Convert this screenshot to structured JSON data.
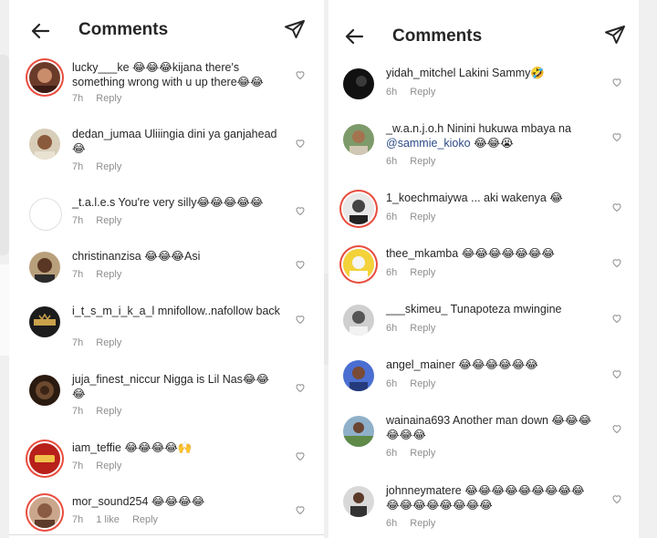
{
  "left": {
    "title": "Comments",
    "comments": [
      {
        "user": "lucky___ke",
        "text": "😂😂😂kijana there's something wrong with u up there😂😂",
        "time": "7h",
        "reply": "Reply",
        "avatar": "photo-woman",
        "ring": true
      },
      {
        "user": "dedan_jumaa",
        "text": "Uliiingia dini ya ganjahead 😂",
        "time": "7h",
        "reply": "Reply",
        "avatar": "photo-man"
      },
      {
        "user": "_t.a.l.e.s",
        "text": "You're very silly😂😂😂😂😂",
        "time": "7h",
        "reply": "Reply",
        "avatar": "blank"
      },
      {
        "user": "christinanzisa",
        "text": "😂😂😂Asi",
        "time": "7h",
        "reply": "Reply",
        "avatar": "photo-woman2"
      },
      {
        "user": "i_t_s_m_i_k_a_l",
        "text": "mnifollow..nafollow back",
        "time": "7h",
        "reply": "Reply",
        "avatar": "logo-mokina"
      },
      {
        "user": "juja_finest_niccur",
        "text": "Nigga is Lil Nas😂😂😂",
        "time": "7h",
        "reply": "Reply",
        "avatar": "photo-dark"
      },
      {
        "user": "iam_teffie",
        "text": "😂😂😂😂🙌",
        "time": "7h",
        "reply": "Reply",
        "avatar": "logo-red",
        "ring": true
      },
      {
        "user": "mor_sound254",
        "text": "😂😂😂😂",
        "time": "7h",
        "likes": "1 like",
        "reply": "Reply",
        "avatar": "photo-woman3",
        "ring": true
      }
    ]
  },
  "right": {
    "title": "Comments",
    "comments": [
      {
        "user": "yidah_mitchel",
        "text": "Lakini Sammy🤣",
        "time": "6h",
        "reply": "Reply",
        "avatar": "photo-dark"
      },
      {
        "user": "_w.a.n.j.o.h",
        "text": "Ninini hukuwa mbaya na",
        "mention": "@sammie_kioko",
        "text2": "😂😂😭",
        "time": "6h",
        "reply": "Reply",
        "avatar": "photo-man"
      },
      {
        "user": "1_koechmaiywa",
        "text": "... aki wakenya 😂",
        "time": "6h",
        "reply": "Reply",
        "avatar": "photo-bw",
        "ring": true
      },
      {
        "user": "thee_mkamba",
        "text": "😂😂😂😂😂😂😂",
        "time": "6h",
        "reply": "Reply",
        "avatar": "photo-yellow",
        "ring": true
      },
      {
        "user": "___skimeu_",
        "text": "Tunapoteza mwingine",
        "time": "6h",
        "reply": "Reply",
        "avatar": "photo-gray"
      },
      {
        "user": "angel_mainer",
        "text": "😂😂😂😂😂😂",
        "time": "6h",
        "reply": "Reply",
        "avatar": "photo-blue"
      },
      {
        "user": "wainaina693",
        "text": "Another man down 😂😂😂😂😂😂",
        "time": "6h",
        "reply": "Reply",
        "avatar": "photo-outdoor"
      },
      {
        "user": "johnneymatere",
        "text": "😂😂😂😂😂😂😂😂😂😂😂😂😂😂😂😂😂",
        "time": "6h",
        "reply": "Reply",
        "avatar": "photo-man2"
      }
    ]
  },
  "colors": {
    "ring": "#e84c3d",
    "meta": "#8e8e8e",
    "mention": "#2c4a86"
  }
}
